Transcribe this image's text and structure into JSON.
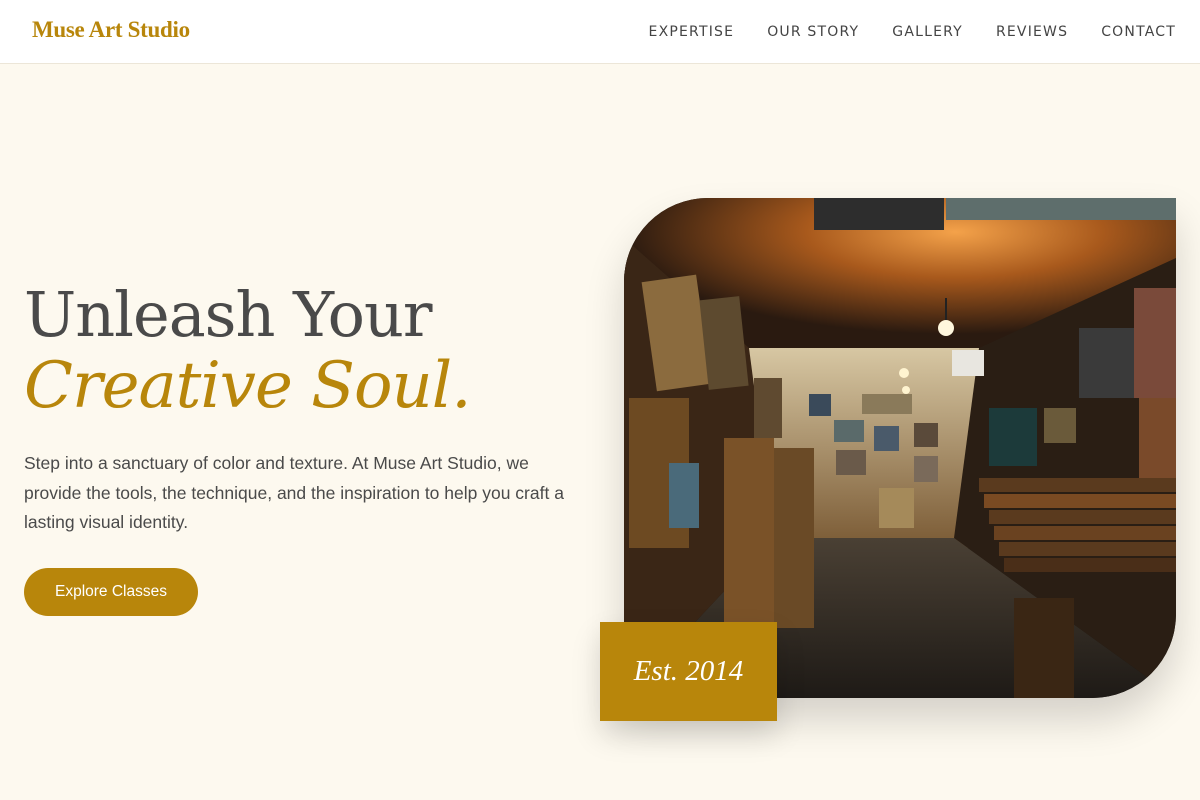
{
  "brand": {
    "name": "Muse Art Studio"
  },
  "nav": {
    "items": [
      "EXPERTISE",
      "OUR STORY",
      "GALLERY",
      "REVIEWS",
      "CONTACT"
    ]
  },
  "hero": {
    "title_line1": "Unleash Your",
    "title_line2": "Creative Soul.",
    "description": "Step into a sanctuary of color and texture. At Muse Art Studio, we provide the tools, the technique, and the inspiration to help you craft a lasting visual identity.",
    "cta_label": "Explore Classes",
    "badge_text": "Est. 2014"
  },
  "colors": {
    "accent": "#b8860b",
    "background": "#fdf9ef",
    "header_bg": "#ffffff",
    "text": "#4a4a4a"
  }
}
